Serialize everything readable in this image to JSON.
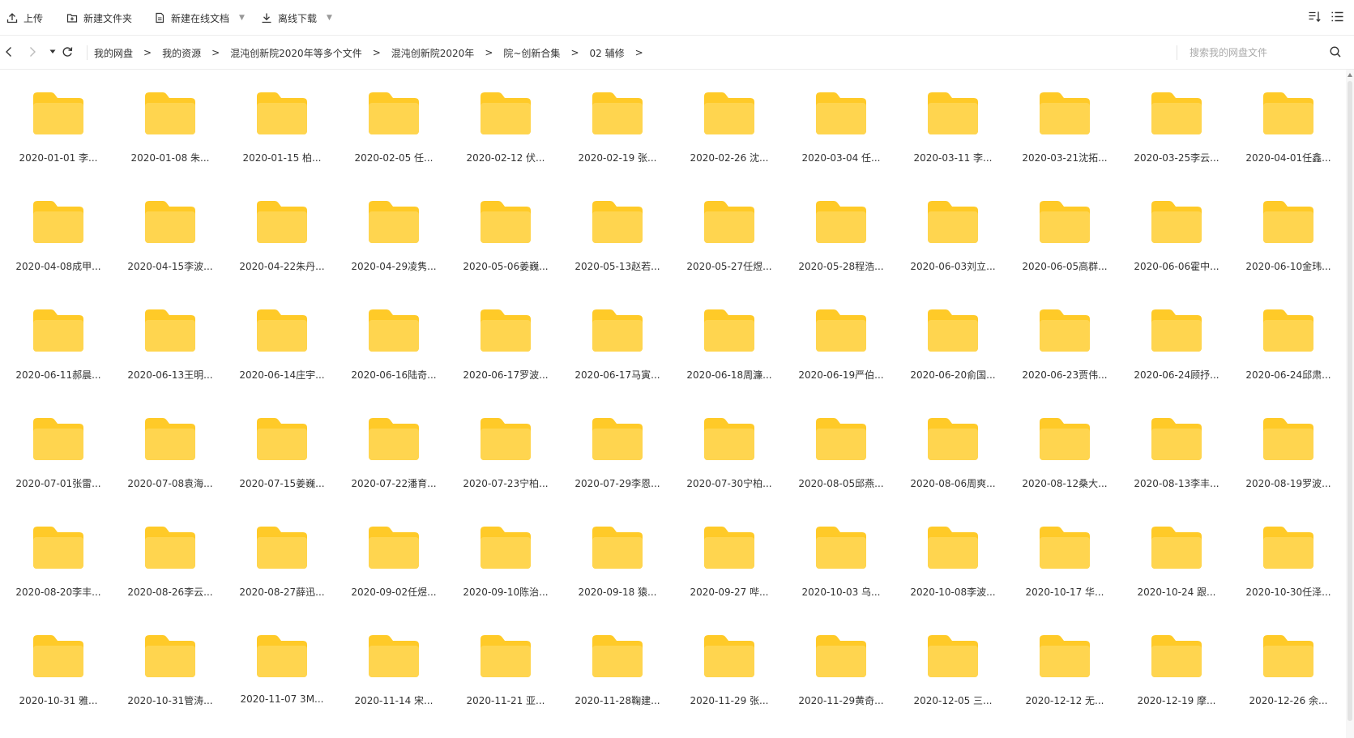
{
  "toolbar": {
    "upload": "上传",
    "new_folder": "新建文件夹",
    "new_doc": "新建在线文档",
    "offline_download": "离线下载"
  },
  "nav": {
    "breadcrumbs": [
      "我的网盘",
      "我的资源",
      "混沌创新院2020年等多个文件",
      "混沌创新院2020年",
      "院~创新合集",
      "02 辅修"
    ],
    "separator": ">",
    "search_placeholder": "搜索我的网盘文件"
  },
  "colors": {
    "folder": "#FFD54F",
    "folder_tab": "#FFCA28"
  },
  "files": [
    "2020-01-01 李...",
    "2020-01-08 朱...",
    "2020-01-15 柏...",
    "2020-02-05 任...",
    "2020-02-12 伏...",
    "2020-02-19 张...",
    "2020-02-26 沈...",
    "2020-03-04 任...",
    "2020-03-11 李...",
    "2020-03-21沈拓...",
    "2020-03-25李云...",
    "2020-04-01任鑫...",
    "2020-04-08成甲...",
    "2020-04-15李波...",
    "2020-04-22朱丹...",
    "2020-04-29凌隽...",
    "2020-05-06姜巍...",
    "2020-05-13赵若...",
    "2020-05-27任煜...",
    "2020-05-28程浩...",
    "2020-06-03刘立...",
    "2020-06-05高群...",
    "2020-06-06霍中...",
    "2020-06-10金玮...",
    "2020-06-11郝晨...",
    "2020-06-13王明...",
    "2020-06-14庄宇...",
    "2020-06-16陆奇...",
    "2020-06-17罗波...",
    "2020-06-17马寅...",
    "2020-06-18周濂...",
    "2020-06-19严伯...",
    "2020-06-20俞国...",
    "2020-06-23贾伟...",
    "2020-06-24顾抒...",
    "2020-06-24邱肃...",
    "2020-07-01张雷...",
    "2020-07-08袁海...",
    "2020-07-15姜巍...",
    "2020-07-22潘育...",
    "2020-07-23宁柏...",
    "2020-07-29李恩...",
    "2020-07-30宁柏...",
    "2020-08-05邱燕...",
    "2020-08-06周爽...",
    "2020-08-12桑大...",
    "2020-08-13李丰...",
    "2020-08-19罗波...",
    "2020-08-20李丰...",
    "2020-08-26李云...",
    "2020-08-27薛迅...",
    "2020-09-02任煜...",
    "2020-09-10陈治...",
    "2020-09-18 猿...",
    "2020-09-27 哔...",
    "2020-10-03 乌...",
    "2020-10-08李波...",
    "2020-10-17 华...",
    "2020-10-24 跟...",
    "2020-10-30任泽...",
    "2020-10-31 雅...",
    "2020-10-31管涛...",
    "2020-11-07 3M...",
    "2020-11-14 宋...",
    "2020-11-21 亚...",
    "2020-11-28鞠建...",
    "2020-11-29 张...",
    "2020-11-29黄奇...",
    "2020-12-05 三...",
    "2020-12-12 无...",
    "2020-12-19 摩...",
    "2020-12-26 余..."
  ]
}
